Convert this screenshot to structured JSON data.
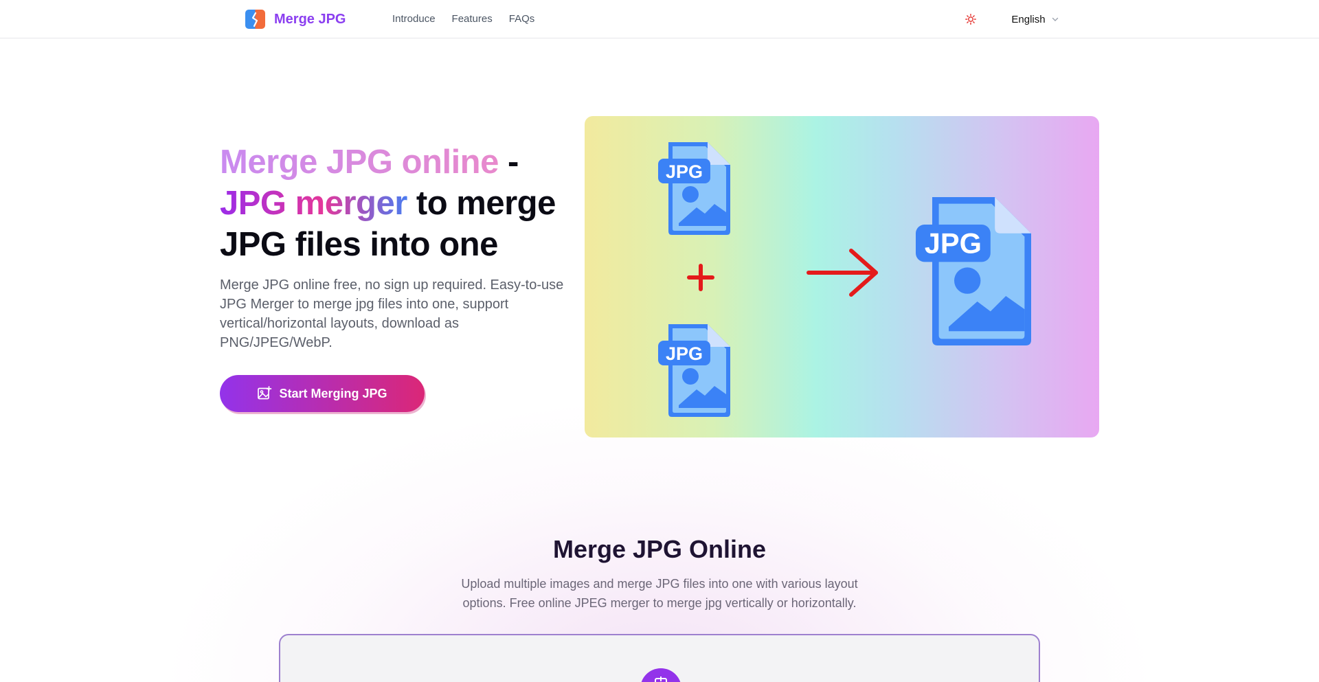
{
  "header": {
    "brand": "Merge JPG",
    "nav": [
      {
        "label": "Introduce"
      },
      {
        "label": "Features"
      },
      {
        "label": "FAQs"
      }
    ],
    "language": "English",
    "icons": {
      "theme": "sun-icon",
      "language_caret": "chevron-down-icon"
    }
  },
  "hero": {
    "title_part1": "Merge JPG online",
    "title_dash": " -",
    "title_part2": "JPG merger",
    "title_part3": " to merge JPG files into one",
    "description": "Merge JPG online free, no sign up required. Easy-to-use JPG Merger to merge jpg files into one, support vertical/horizontal layouts, download as PNG/JPEG/WebP.",
    "cta_label": "Start Merging JPG",
    "illustration": {
      "file_label_small": "JPG",
      "file_label_large": "JPG"
    }
  },
  "section": {
    "title": "Merge JPG Online",
    "description": "Upload multiple images and merge JPG files into one with various layout options. Free online JPEG merger to merge jpg vertically or horizontally."
  },
  "colors": {
    "brand": "#8b3ff0",
    "cta_start": "#9333ea",
    "cta_end": "#db2777",
    "file_icon": "#3b82f6",
    "plus_arrow": "#e41b1b"
  }
}
